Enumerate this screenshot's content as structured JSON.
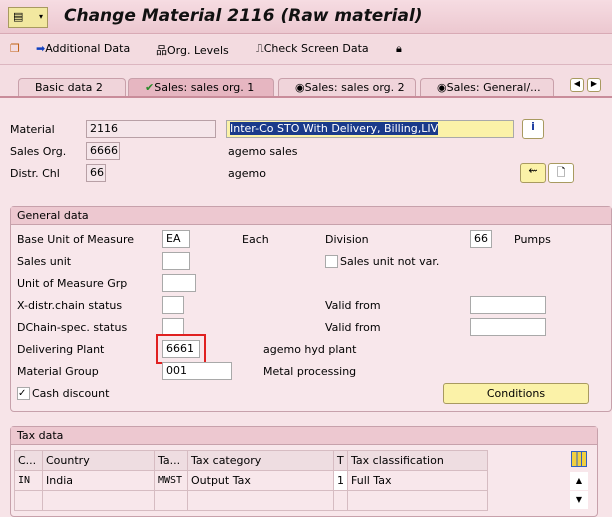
{
  "window": {
    "title": "Change Material 2116 (Raw material)"
  },
  "toolbar": {
    "additional_data": "Additional Data",
    "org_levels": "Org. Levels",
    "check_screen_data": "Check Screen Data"
  },
  "tabs": [
    {
      "label": "Basic data 2"
    },
    {
      "label": "Sales: sales org. 1",
      "active": true
    },
    {
      "label": "Sales: sales org. 2"
    },
    {
      "label": "Sales: General/..."
    }
  ],
  "header": {
    "material_label": "Material",
    "material": "2116",
    "material_desc": "Inter-Co STO With Delivery, Billing,LIV",
    "sales_org_label": "Sales Org.",
    "sales_org": "6666",
    "sales_org_desc": "agemo sales",
    "distr_label": "Distr. Chl",
    "distr": "66",
    "distr_desc": "agemo"
  },
  "general": {
    "title": "General data",
    "base_uom_label": "Base Unit of Measure",
    "base_uom": "EA",
    "base_uom_desc": "Each",
    "division_label": "Division",
    "division": "66",
    "division_desc": "Pumps",
    "sales_unit_label": "Sales unit",
    "sales_unit_not_var_label": "Sales unit not var.",
    "uom_grp_label": "Unit of Measure Grp",
    "xdistr_label": "X-distr.chain status",
    "valid_from_label": "Valid from",
    "dchain_label": "DChain-spec. status",
    "valid_from2_label": "Valid from",
    "plant_label": "Delivering Plant",
    "plant": "6661",
    "plant_desc": "agemo hyd plant",
    "matgrp_label": "Material Group",
    "matgrp": "001",
    "matgrp_desc": "Metal processing",
    "cash_discount_label": "Cash discount",
    "cash_discount": true,
    "conditions_button": "Conditions"
  },
  "tax": {
    "title": "Tax data",
    "columns": [
      "C...",
      "Country",
      "Ta...",
      "Tax category",
      "T",
      "Tax classification"
    ],
    "rows": [
      [
        "IN",
        "India",
        "MWST",
        "Output Tax",
        "1",
        "Full Tax"
      ]
    ]
  },
  "colors": {
    "highlight": "#e02020",
    "accent_yellow": "#fbf2a8"
  }
}
